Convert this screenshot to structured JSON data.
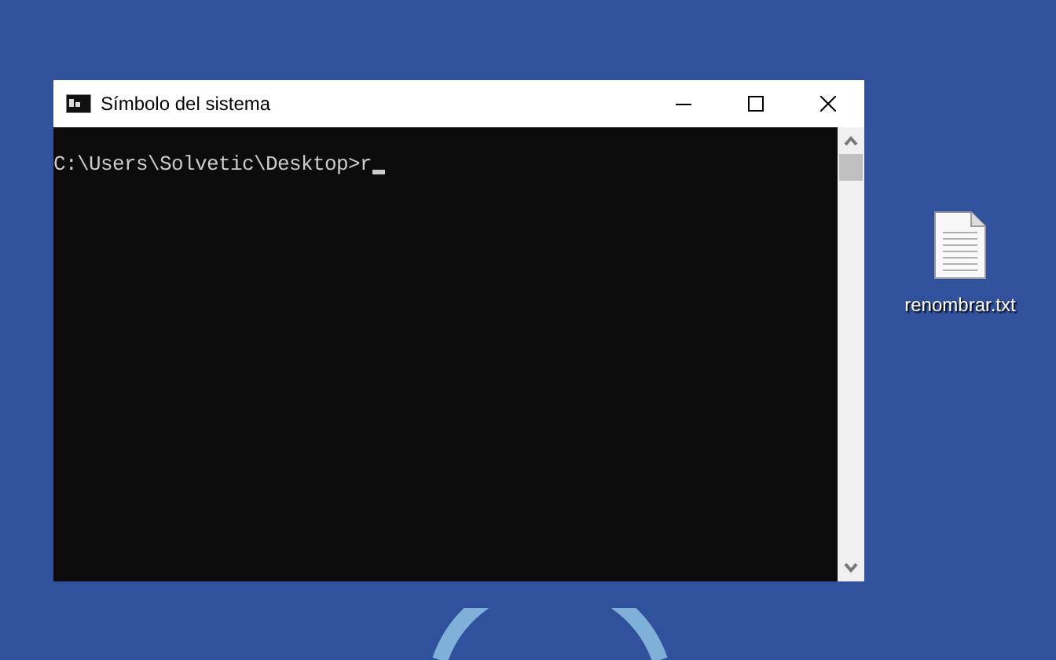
{
  "window": {
    "title": "Símbolo del sistema",
    "console": {
      "prompt": "C:\\Users\\Solvetic\\Desktop>",
      "input": "r"
    }
  },
  "desktop_icons": [
    {
      "label": "renombrar.txt"
    }
  ]
}
